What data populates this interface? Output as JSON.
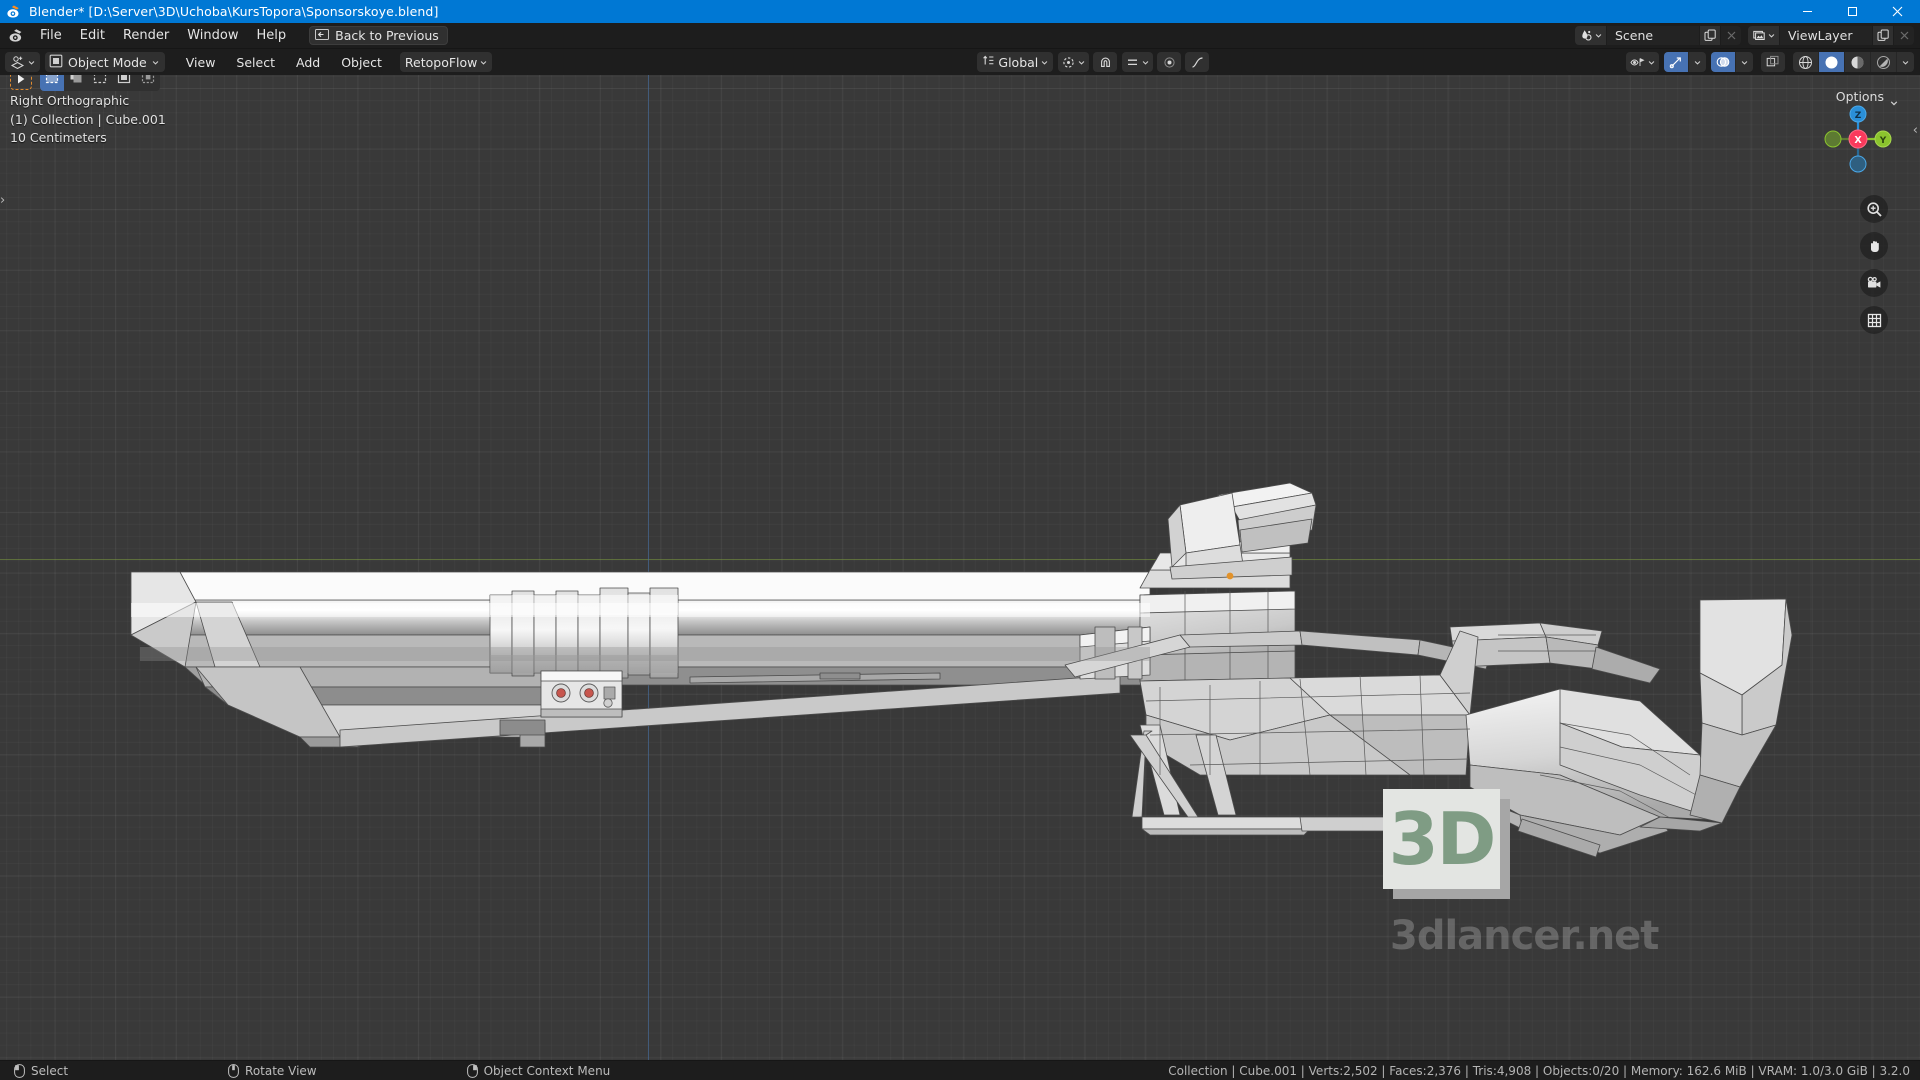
{
  "window": {
    "title": "Blender* [D:\\Server\\3D\\Uchoba\\KursTopora\\Sponsorskoye.blend]",
    "app_icon": "blender-logo-icon",
    "minimize": "minimize-icon",
    "maximize": "maximize-icon",
    "close": "close-icon"
  },
  "topbar": {
    "menus": [
      "File",
      "Edit",
      "Render",
      "Window",
      "Help"
    ],
    "back_to_previous": "Back to Previous",
    "scene": {
      "label": "Scene",
      "icon": "scene-icon",
      "new_icon": "duplicate-icon",
      "unlink_icon": "x-icon"
    },
    "viewlayer": {
      "label": "ViewLayer",
      "icon": "viewlayer-icon",
      "new_icon": "duplicate-icon",
      "unlink_icon": "x-icon"
    }
  },
  "viewheader": {
    "editor_type_icon": "editor-type-icon",
    "mode": "Object Mode",
    "mode_icon": "object-mode-icon",
    "menus": [
      "View",
      "Select",
      "Add",
      "Object"
    ],
    "addon_menu": "RetopoFlow",
    "transform_orientation": "Global",
    "orientation_icon": "orientation-icon",
    "snap_icon": "magnet-icon",
    "proportional_icon": "proportional-edit-icon",
    "falloff_icon": "falloff-icon",
    "visibility_icon": "eye-icon",
    "gizmo_icon": "gizmo-icon",
    "overlays_icon": "overlays-icon",
    "xray_icon": "xray-icon",
    "shading_modes": [
      "wireframe",
      "solid",
      "material",
      "rendered"
    ],
    "shading_active": "solid",
    "options_label": "Options"
  },
  "toolbar": {
    "tools": [
      "tweak-select-tool",
      "select-box-tool",
      "select-circle-tool",
      "select-lasso-tool"
    ],
    "select_modes": [
      "set",
      "extend",
      "subtract",
      "invert",
      "intersect"
    ],
    "active_select_mode": 0
  },
  "viewport": {
    "view_name": "Right Orthographic",
    "collection_object": "(1) Collection | Cube.001",
    "grid_scale": "10 Centimeters",
    "gizmo": {
      "axis_x": "X",
      "axis_y": "Y",
      "axis_z": "Z",
      "color_x": "#fa3a5c",
      "color_y": "#8bc42e",
      "color_z": "#2a8fd8"
    },
    "nav_buttons": [
      "zoom-icon",
      "pan-hand-icon",
      "camera-view-icon",
      "toggle-ortho-grid-icon"
    ],
    "background": "#393939"
  },
  "watermark": {
    "logo_text": "3D",
    "site_text": "3dlancer.net",
    "logo_color": "#7f9c84"
  },
  "statusbar": {
    "keymap": [
      {
        "icon": "mouse-left-icon",
        "label": "Select"
      },
      {
        "icon": "mouse-middle-icon",
        "label": "Rotate View"
      },
      {
        "icon": "mouse-right-icon",
        "label": "Object Context Menu"
      }
    ],
    "stats": "Collection | Cube.001 | Verts:2,502 | Faces:2,376 | Tris:4,908 | Objects:0/20 | Memory: 162.6 MiB | VRAM: 1.0/3.0 GiB | 3.2.0"
  }
}
